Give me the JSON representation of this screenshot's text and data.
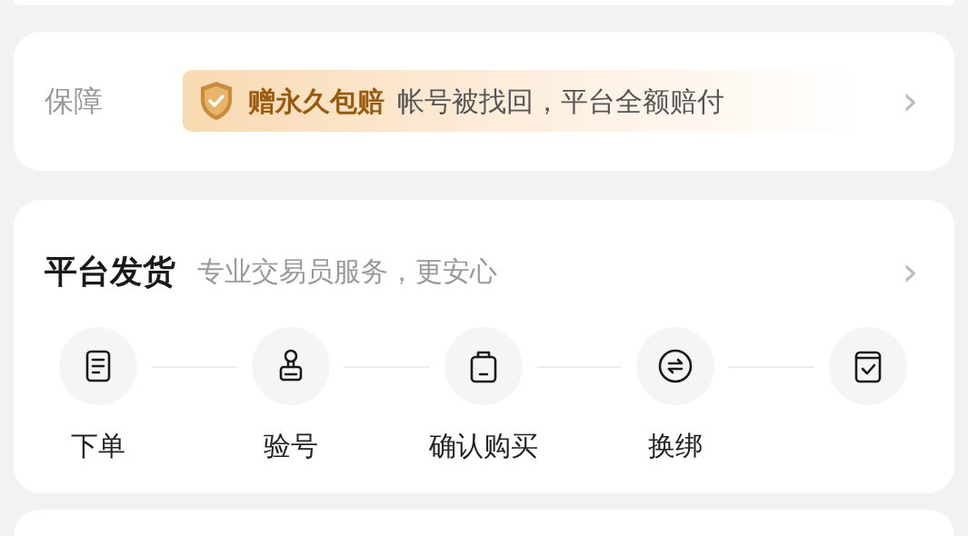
{
  "guarantee": {
    "label": "保障",
    "badge": "赠永久包赔",
    "description": "帐号被找回，平台全额赔付",
    "arrow": "›"
  },
  "delivery": {
    "title": "平台发货",
    "subtitle": "专业交易员服务，更安心",
    "arrow": "›",
    "steps": [
      {
        "kind": "document",
        "label": "下单"
      },
      {
        "kind": "stamp",
        "label": "验号"
      },
      {
        "kind": "bag",
        "label": "确认购买"
      },
      {
        "kind": "exchange",
        "label": "换绑"
      },
      {
        "kind": "box"
      }
    ]
  }
}
